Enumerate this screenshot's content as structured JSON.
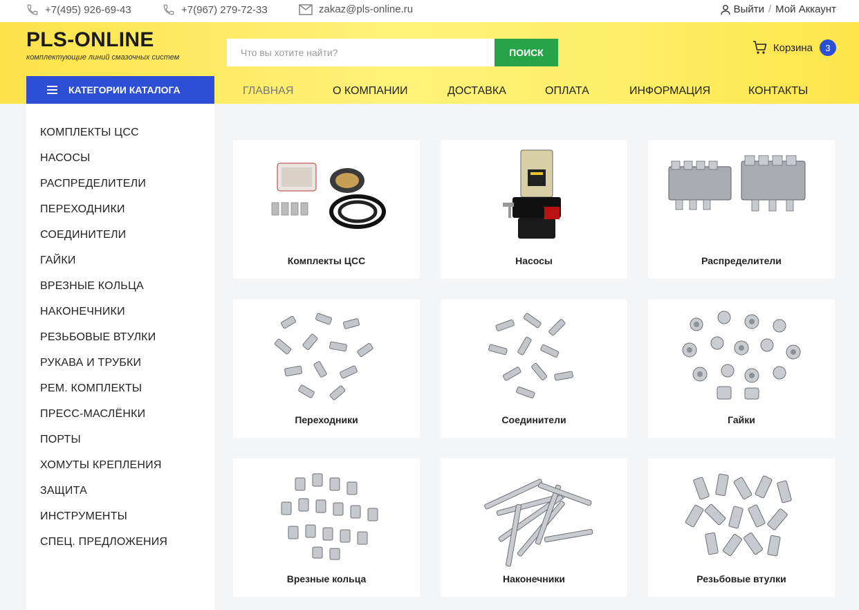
{
  "topbar": {
    "phone1": "+7(495) 926-69-43",
    "phone2": "+7(967) 279-72-33",
    "email": "zakaz@pls-online.ru",
    "logout": "Выйти",
    "separator": "/",
    "account": "Мой Аккаунт"
  },
  "header": {
    "logo": "PLS-ONLINE",
    "slogan": "комплектующие линий смазочных систем",
    "search_placeholder": "Что вы хотите найти?",
    "search_button": "ПОИСК",
    "cart_label": "Корзина",
    "cart_count": "3",
    "catalog_button": "КАТЕГОРИИ КАТАЛОГА"
  },
  "nav": [
    "ГЛАВНАЯ",
    "О КОМПАНИИ",
    "ДОСТАВКА",
    "ОПЛАТА",
    "ИНФОРМАЦИЯ",
    "КОНТАКТЫ"
  ],
  "sidebar": [
    "КОМПЛЕКТЫ ЦСС",
    "НАСОСЫ",
    "РАСПРЕДЕЛИТЕЛИ",
    "ПЕРЕХОДНИКИ",
    "СОЕДИНИТЕЛИ",
    "ГАЙКИ",
    "ВРЕЗНЫЕ КОЛЬЦА",
    "НАКОНЕЧНИКИ",
    "РЕЗЬБОВЫЕ ВТУЛКИ",
    "РУКАВА И ТРУБКИ",
    "РЕМ. КОМПЛЕКТЫ",
    "ПРЕСС-МАСЛЁНКИ",
    "ПОРТЫ",
    "ХОМУТЫ КРЕПЛЕНИЯ",
    "ЗАЩИТА",
    "ИНСТРУМЕНТЫ",
    "СПЕЦ. ПРЕДЛОЖЕНИЯ"
  ],
  "cards": [
    "Комплекты ЦСС",
    "Насосы",
    "Распределители",
    "Переходники",
    "Соединители",
    "Гайки",
    "Врезные кольца",
    "Наконечники",
    "Резьбовые втулки"
  ],
  "colors": {
    "brand_yellow": "#fde34a",
    "accent_blue": "#2c4fd6",
    "search_green": "#27a348"
  }
}
